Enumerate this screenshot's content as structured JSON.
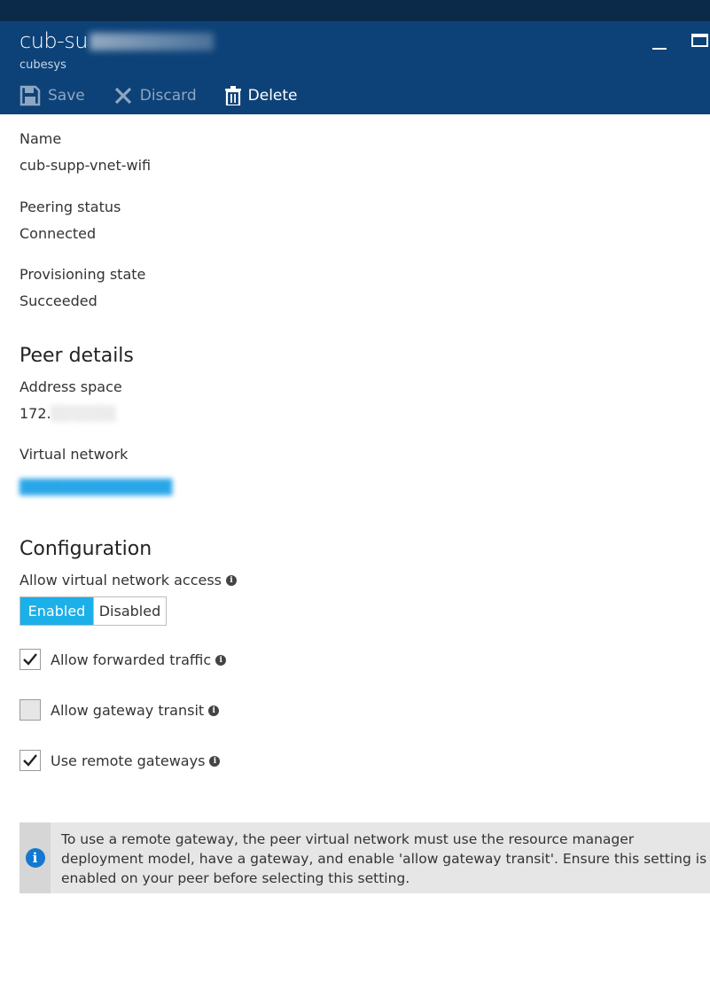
{
  "header": {
    "title_visible": "cub-su",
    "subtitle": "cubesys",
    "toolbar": {
      "save_label": "Save",
      "discard_label": "Discard",
      "delete_label": "Delete"
    }
  },
  "fields": {
    "name_label": "Name",
    "name_value": "cub-supp-vnet-wifi",
    "peering_label": "Peering status",
    "peering_value": "Connected",
    "provisioning_label": "Provisioning state",
    "provisioning_value": "Succeeded"
  },
  "peer": {
    "section_title": "Peer details",
    "address_label": "Address space",
    "address_prefix": "172.",
    "vnet_label": "Virtual network"
  },
  "config": {
    "section_title": "Configuration",
    "access_label": "Allow virtual network access",
    "toggle": {
      "enabled": "Enabled",
      "disabled": "Disabled",
      "selected": "Enabled"
    },
    "forwarded_label": "Allow forwarded traffic",
    "forwarded_checked": true,
    "gateway_transit_label": "Allow gateway transit",
    "gateway_transit_checked": false,
    "remote_gateways_label": "Use remote gateways",
    "remote_gateways_checked": true
  },
  "info": {
    "message": "To use a remote gateway, the peer virtual network must use the resource manager deployment model, have a gateway, and enable 'allow gateway transit'. Ensure this setting is enabled on your peer before selecting this setting."
  },
  "colors": {
    "header_bg": "#0d4278",
    "topbar_bg": "#0b2a4a",
    "toggle_active": "#1bb0e8",
    "info_icon": "#1578d0"
  }
}
